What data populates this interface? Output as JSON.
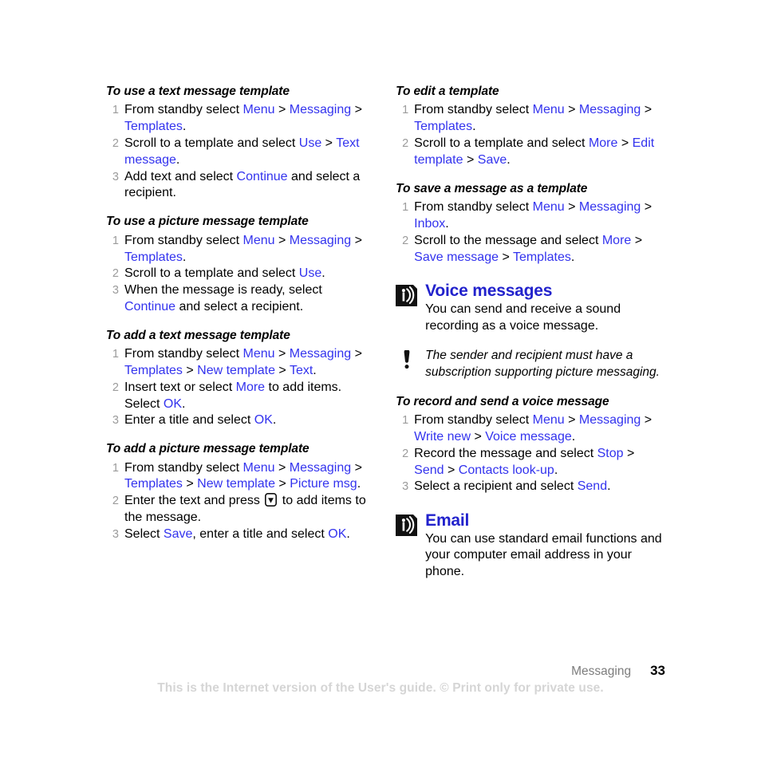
{
  "document": {
    "footer": {
      "chapter": "Messaging",
      "page_number": "33",
      "watermark": "This is the Internet version of the User's guide. © Print only for private use."
    }
  },
  "left_column": {
    "procedures": [
      {
        "title": "To use a text message template",
        "steps": [
          {
            "num": "1",
            "parts": [
              {
                "t": "From standby select ",
                "k": "plain"
              },
              {
                "t": "Menu",
                "k": "link"
              },
              {
                "t": " > ",
                "k": "plain"
              },
              {
                "t": "Messaging",
                "k": "link"
              },
              {
                "t": " > ",
                "k": "plain"
              },
              {
                "t": "Templates",
                "k": "link"
              },
              {
                "t": ".",
                "k": "plain"
              }
            ]
          },
          {
            "num": "2",
            "parts": [
              {
                "t": "Scroll to a template and select ",
                "k": "plain"
              },
              {
                "t": "Use",
                "k": "link"
              },
              {
                "t": " > ",
                "k": "plain"
              },
              {
                "t": "Text message",
                "k": "link"
              },
              {
                "t": ".",
                "k": "plain"
              }
            ]
          },
          {
            "num": "3",
            "parts": [
              {
                "t": "Add text and select ",
                "k": "plain"
              },
              {
                "t": "Continue",
                "k": "link"
              },
              {
                "t": " and select a recipient.",
                "k": "plain"
              }
            ]
          }
        ]
      },
      {
        "title": "To use a picture message template",
        "steps": [
          {
            "num": "1",
            "parts": [
              {
                "t": "From standby select ",
                "k": "plain"
              },
              {
                "t": "Menu",
                "k": "link"
              },
              {
                "t": " > ",
                "k": "plain"
              },
              {
                "t": "Messaging",
                "k": "link"
              },
              {
                "t": " > ",
                "k": "plain"
              },
              {
                "t": "Templates",
                "k": "link"
              },
              {
                "t": ".",
                "k": "plain"
              }
            ]
          },
          {
            "num": "2",
            "parts": [
              {
                "t": "Scroll to a template and select ",
                "k": "plain"
              },
              {
                "t": "Use",
                "k": "link"
              },
              {
                "t": ".",
                "k": "plain"
              }
            ]
          },
          {
            "num": "3",
            "parts": [
              {
                "t": "When the message is ready, select ",
                "k": "plain"
              },
              {
                "t": "Continue",
                "k": "link"
              },
              {
                "t": " and select a recipient.",
                "k": "plain"
              }
            ]
          }
        ]
      },
      {
        "title": "To add a text message template",
        "steps": [
          {
            "num": "1",
            "parts": [
              {
                "t": "From standby select ",
                "k": "plain"
              },
              {
                "t": "Menu",
                "k": "link"
              },
              {
                "t": " > ",
                "k": "plain"
              },
              {
                "t": "Messaging",
                "k": "link"
              },
              {
                "t": " > ",
                "k": "plain"
              },
              {
                "t": "Templates",
                "k": "link"
              },
              {
                "t": " > ",
                "k": "plain"
              },
              {
                "t": "New template",
                "k": "link"
              },
              {
                "t": " > ",
                "k": "plain"
              },
              {
                "t": "Text",
                "k": "link"
              },
              {
                "t": ".",
                "k": "plain"
              }
            ]
          },
          {
            "num": "2",
            "parts": [
              {
                "t": "Insert text or select ",
                "k": "plain"
              },
              {
                "t": "More",
                "k": "link"
              },
              {
                "t": " to add items. Select ",
                "k": "plain"
              },
              {
                "t": "OK",
                "k": "link"
              },
              {
                "t": ".",
                "k": "plain"
              }
            ]
          },
          {
            "num": "3",
            "parts": [
              {
                "t": "Enter a title and select ",
                "k": "plain"
              },
              {
                "t": "OK",
                "k": "link"
              },
              {
                "t": ".",
                "k": "plain"
              }
            ]
          }
        ]
      },
      {
        "title": "To add a picture message template",
        "steps": [
          {
            "num": "1",
            "parts": [
              {
                "t": "From standby select ",
                "k": "plain"
              },
              {
                "t": "Menu",
                "k": "link"
              },
              {
                "t": " > ",
                "k": "plain"
              },
              {
                "t": "Messaging",
                "k": "link"
              },
              {
                "t": " > ",
                "k": "plain"
              },
              {
                "t": "Templates",
                "k": "link"
              },
              {
                "t": " > ",
                "k": "plain"
              },
              {
                "t": "New template",
                "k": "link"
              },
              {
                "t": " > ",
                "k": "plain"
              },
              {
                "t": "Picture msg",
                "k": "link"
              },
              {
                "t": ".",
                "k": "plain"
              }
            ]
          },
          {
            "num": "2",
            "parts": [
              {
                "t": "Enter the text and press ",
                "k": "plain"
              },
              {
                "t": "navigation-key-down-icon",
                "k": "icon"
              },
              {
                "t": " to add items to the message.",
                "k": "plain"
              }
            ]
          },
          {
            "num": "3",
            "parts": [
              {
                "t": "Select ",
                "k": "plain"
              },
              {
                "t": "Save",
                "k": "link"
              },
              {
                "t": ", enter a title and select ",
                "k": "plain"
              },
              {
                "t": "OK",
                "k": "link"
              },
              {
                "t": ".",
                "k": "plain"
              }
            ]
          }
        ]
      }
    ]
  },
  "right_column": {
    "procedures_top": [
      {
        "title": "To edit a template",
        "steps": [
          {
            "num": "1",
            "parts": [
              {
                "t": "From standby select ",
                "k": "plain"
              },
              {
                "t": "Menu",
                "k": "link"
              },
              {
                "t": " > ",
                "k": "plain"
              },
              {
                "t": "Messaging",
                "k": "link"
              },
              {
                "t": " > ",
                "k": "plain"
              },
              {
                "t": "Templates",
                "k": "link"
              },
              {
                "t": ".",
                "k": "plain"
              }
            ]
          },
          {
            "num": "2",
            "parts": [
              {
                "t": "Scroll to a template and select ",
                "k": "plain"
              },
              {
                "t": "More",
                "k": "link"
              },
              {
                "t": " > ",
                "k": "plain"
              },
              {
                "t": "Edit template",
                "k": "link"
              },
              {
                "t": " > ",
                "k": "plain"
              },
              {
                "t": "Save",
                "k": "link"
              },
              {
                "t": ".",
                "k": "plain"
              }
            ]
          }
        ]
      },
      {
        "title": "To save a message as a template",
        "steps": [
          {
            "num": "1",
            "parts": [
              {
                "t": "From standby select ",
                "k": "plain"
              },
              {
                "t": "Menu",
                "k": "link"
              },
              {
                "t": " > ",
                "k": "plain"
              },
              {
                "t": "Messaging",
                "k": "link"
              },
              {
                "t": " > ",
                "k": "plain"
              },
              {
                "t": "Inbox",
                "k": "link"
              },
              {
                "t": ".",
                "k": "plain"
              }
            ]
          },
          {
            "num": "2",
            "parts": [
              {
                "t": "Scroll to the message and select ",
                "k": "plain"
              },
              {
                "t": "More",
                "k": "link"
              },
              {
                "t": " > ",
                "k": "plain"
              },
              {
                "t": "Save message",
                "k": "link"
              },
              {
                "t": " > ",
                "k": "plain"
              },
              {
                "t": "Templates",
                "k": "link"
              },
              {
                "t": ".",
                "k": "plain"
              }
            ]
          }
        ]
      }
    ],
    "voice_section": {
      "icon": "network-service-icon",
      "title": "Voice messages",
      "body": "You can send and receive a sound recording as a voice message.",
      "note": {
        "icon": "exclamation-icon",
        "text": "The sender and recipient must have a subscription supporting picture messaging."
      },
      "procedure": {
        "title": "To record and send a voice message",
        "steps": [
          {
            "num": "1",
            "parts": [
              {
                "t": "From standby select ",
                "k": "plain"
              },
              {
                "t": "Menu",
                "k": "link"
              },
              {
                "t": " > ",
                "k": "plain"
              },
              {
                "t": "Messaging",
                "k": "link"
              },
              {
                "t": " > ",
                "k": "plain"
              },
              {
                "t": "Write new",
                "k": "link"
              },
              {
                "t": " > ",
                "k": "plain"
              },
              {
                "t": "Voice message",
                "k": "link"
              },
              {
                "t": ".",
                "k": "plain"
              }
            ]
          },
          {
            "num": "2",
            "parts": [
              {
                "t": "Record the message and select ",
                "k": "plain"
              },
              {
                "t": "Stop",
                "k": "link"
              },
              {
                "t": " > ",
                "k": "plain"
              },
              {
                "t": "Send",
                "k": "link"
              },
              {
                "t": " > ",
                "k": "plain"
              },
              {
                "t": "Contacts look-up",
                "k": "link"
              },
              {
                "t": ".",
                "k": "plain"
              }
            ]
          },
          {
            "num": "3",
            "parts": [
              {
                "t": "Select a recipient and select ",
                "k": "plain"
              },
              {
                "t": "Send",
                "k": "link"
              },
              {
                "t": ".",
                "k": "plain"
              }
            ]
          }
        ]
      }
    },
    "email_section": {
      "icon": "network-service-icon",
      "title": "Email",
      "body": "You can use standard email functions and your computer email address in your phone."
    }
  },
  "colors": {
    "link": "#3333ee",
    "heading": "#2222cc",
    "step_number": "#9b9b9b",
    "footer_chapter": "#7d7d7d",
    "watermark": "#d5d5d5",
    "text": "#000000"
  }
}
